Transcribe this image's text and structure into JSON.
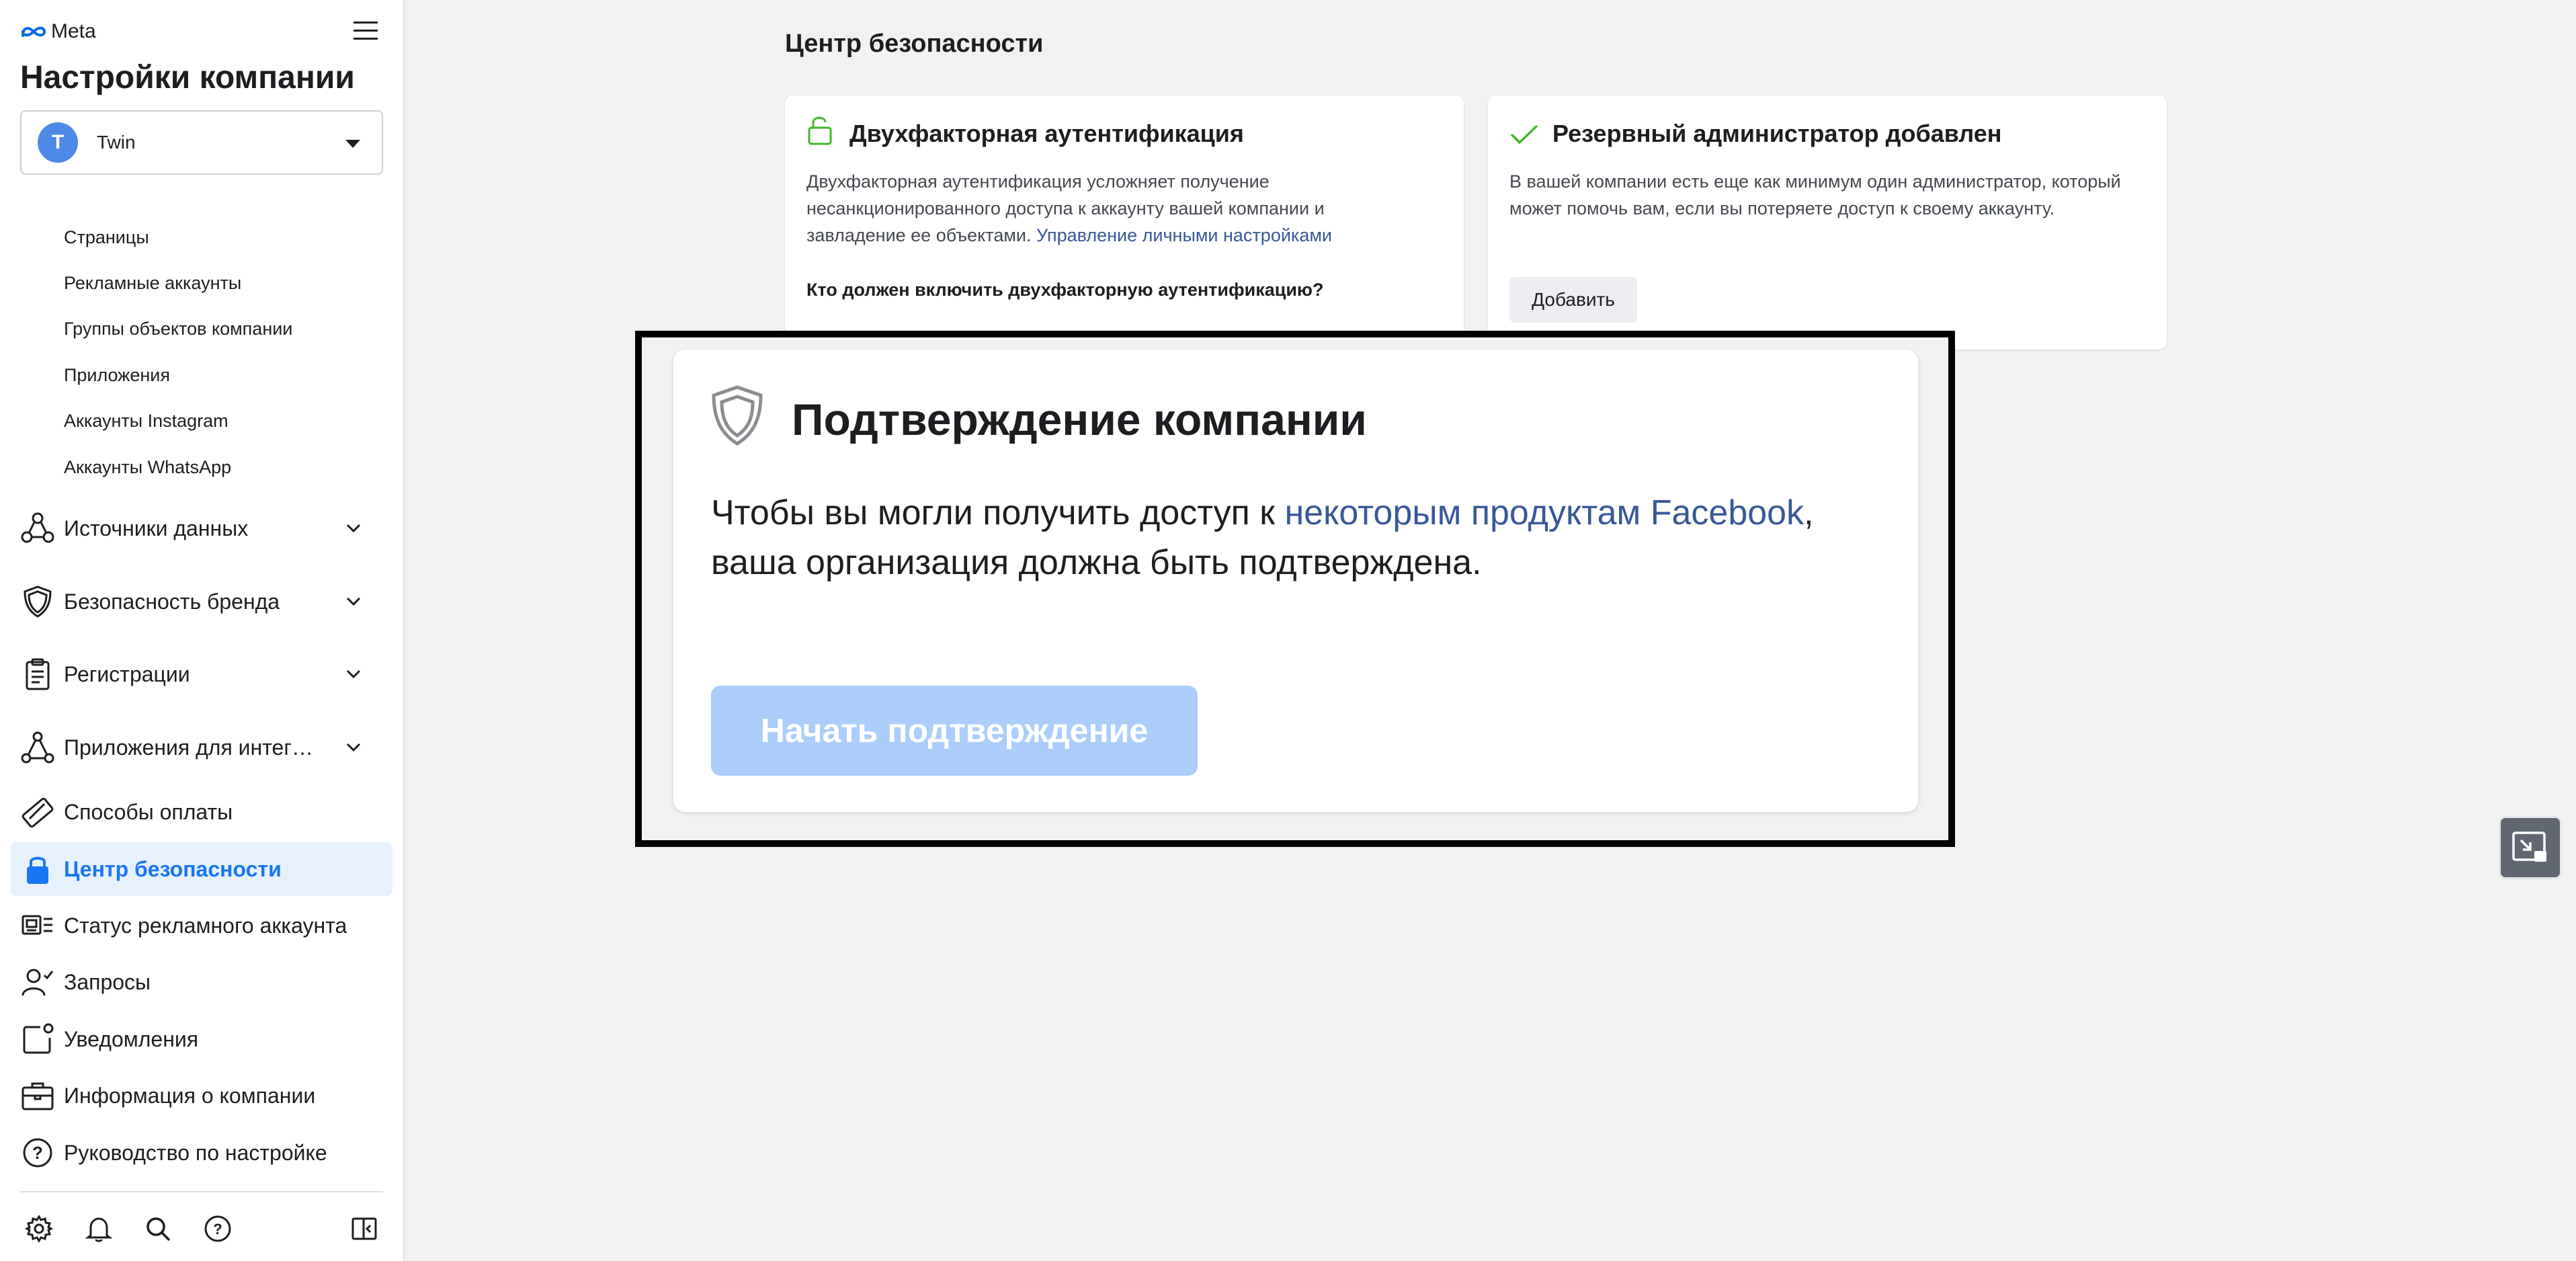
{
  "brand": {
    "logo_text": "Meta",
    "accent": "#1877f2",
    "link": "#385898"
  },
  "sidebar": {
    "title": "Настройки компании",
    "account": {
      "initial": "T",
      "name": "Twin"
    },
    "sub_items": [
      {
        "label": "Страницы"
      },
      {
        "label": "Рекламные аккаунты"
      },
      {
        "label": "Группы объектов компании"
      },
      {
        "label": "Приложения"
      },
      {
        "label": "Аккаунты Instagram"
      },
      {
        "label": "Аккаунты WhatsApp"
      }
    ],
    "nav": [
      {
        "label": "Источники данных",
        "icon": "data-sources-icon"
      },
      {
        "label": "Безопасность бренда",
        "icon": "shield-icon"
      },
      {
        "label": "Регистрации",
        "icon": "clipboard-icon"
      },
      {
        "label": "Приложения для интег…",
        "icon": "integrations-icon"
      },
      {
        "label": "Способы оплаты",
        "icon": "payment-icon"
      },
      {
        "label": "Центр безопасности",
        "icon": "lock-icon",
        "active": true
      },
      {
        "label": "Статус рекламного аккаунта",
        "icon": "ad-status-icon"
      },
      {
        "label": "Запросы",
        "icon": "requests-icon"
      },
      {
        "label": "Уведомления",
        "icon": "notifications-icon"
      },
      {
        "label": "Информация о компании",
        "icon": "briefcase-icon"
      },
      {
        "label": "Руководство по настройке",
        "icon": "help-icon"
      }
    ],
    "bottom_icons": [
      "settings-icon",
      "bell-icon",
      "search-icon",
      "help-icon",
      "panel-toggle-icon"
    ]
  },
  "main": {
    "section_title": "Центр безопасности",
    "two_factor": {
      "title": "Двухфакторная аутентификация",
      "body": "Двухфакторная аутентификация усложняет получение несанкционированного доступа к аккаунту вашей компании и завладение ее объектами.",
      "link": "Управление личными настройками",
      "question": "Кто должен включить двухфакторную аутентификацию?"
    },
    "backup_admin": {
      "title": "Резервный администратор добавлен",
      "body": "В вашей компании есть еще как минимум один администратор, который может помочь вам, если вы потеряете доступ к своему аккаунту.",
      "button": "Добавить"
    },
    "verification": {
      "title": "Подтверждение компании",
      "body_start": "Чтобы вы могли получить доступ к ",
      "body_link": "некоторым продуктам Facebook",
      "body_end": ", ваша организация должна быть подтверждена.",
      "button": "Начать подтверждение"
    }
  }
}
